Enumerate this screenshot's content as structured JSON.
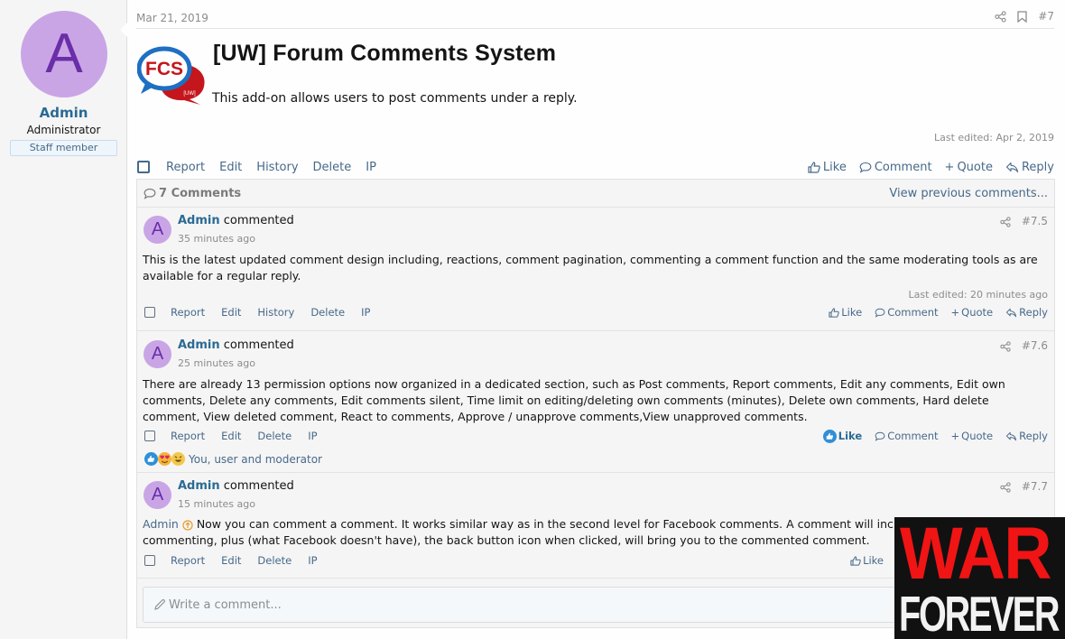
{
  "author": {
    "avatar_letter": "A",
    "name": "Admin",
    "title": "Administrator",
    "badge": "Staff member"
  },
  "post": {
    "date": "Mar 21, 2019",
    "number": "#7",
    "logo_text": "FCS",
    "logo_sub": "[UW]",
    "title": "[UW] Forum Comments System",
    "body": "This add-on allows users to post comments under a reply.",
    "last_edited": "Last edited: Apr 2, 2019",
    "actions": [
      "Report",
      "Edit",
      "History",
      "Delete",
      "IP"
    ],
    "right_actions": {
      "like": "Like",
      "comment": "Comment",
      "quote": "Quote",
      "reply": "Reply"
    }
  },
  "comments": {
    "count_label": "7 Comments",
    "view_previous": "View previous comments...",
    "items": [
      {
        "avatar_letter": "A",
        "author": "Admin",
        "verb": "commented",
        "time": "35 minutes ago",
        "number": "#7.5",
        "text": "This is the latest updated comment design including, reactions, comment pagination, commenting a comment function and the same moderating tools as are available for a regular reply.",
        "last_edited": "Last edited: 20 minutes ago",
        "actions": [
          "Report",
          "Edit",
          "History",
          "Delete",
          "IP"
        ],
        "right_actions": {
          "like": "Like",
          "comment": "Comment",
          "quote": "Quote",
          "reply": "Reply"
        }
      },
      {
        "avatar_letter": "A",
        "author": "Admin",
        "verb": "commented",
        "time": "25 minutes ago",
        "number": "#7.6",
        "text": "There are already 13 permission options now organized in a dedicated section, such as Post comments, Report comments, Edit any comments, Edit own comments, Delete any comments, Edit comments silent, Time limit on editing/deleting own comments (minutes), Delete own comments, Hard delete comment, View deleted comment, React to comments, Approve / unapprove comments,View unapproved comments.",
        "actions": [
          "Report",
          "Edit",
          "Delete",
          "IP"
        ],
        "right_actions": {
          "like": "Like",
          "comment": "Comment",
          "quote": "Quote",
          "reply": "Reply"
        },
        "liked": true,
        "reactions": {
          "emojis": [
            "like",
            "love",
            "haha"
          ],
          "summary": "You, user and moderator"
        }
      },
      {
        "avatar_letter": "A",
        "author": "Admin",
        "verb": "commented",
        "time": "15 minutes ago",
        "number": "#7.7",
        "mention": "Admin",
        "text": "Now you can comment a comment. It works similar way as in the second level for Facebook comments. A comment will include the user commenting, plus (what Facebook doesn't have), the back button icon when clicked, will bring you to the commented comment.",
        "actions": [
          "Report",
          "Edit",
          "Delete",
          "IP"
        ],
        "right_actions": {
          "like": "Like"
        }
      }
    ],
    "write_placeholder": "Write a comment..."
  },
  "overlay": {
    "line1": "WAR",
    "line2": "FOREVER"
  },
  "colors": {
    "link": "#47698a",
    "username": "#2b6a94",
    "avatar_bg": "#c9a5e6",
    "avatar_fg": "#6a2ea8"
  }
}
